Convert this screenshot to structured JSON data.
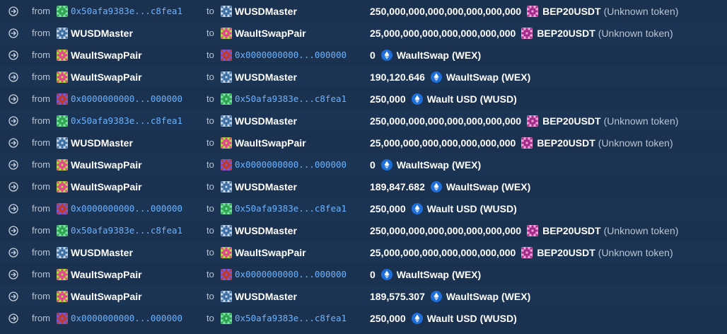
{
  "labels": {
    "from": "from",
    "to": "to"
  },
  "entities": {
    "addr50": {
      "text": "0x50afa9383e...c8fea1",
      "kind": "address",
      "avatar_colors": [
        "#2ea44f",
        "#7ee2a8"
      ]
    },
    "zero": {
      "text": "0x0000000000...000000",
      "kind": "address",
      "avatar_colors": [
        "#c0392b",
        "#6c5ce7"
      ]
    },
    "master": {
      "text": "WUSDMaster",
      "kind": "name",
      "avatar_colors": [
        "#3a6ea5",
        "#c9d6e3"
      ]
    },
    "pair": {
      "text": "WaultSwapPair",
      "kind": "name",
      "avatar_colors": [
        "#e84393",
        "#a3e635"
      ]
    }
  },
  "tokens": {
    "usdt": {
      "name": "BEP20USDT",
      "symbol": "(Unknown token)",
      "icon": "pixel-avatar-icon",
      "colors": [
        "#a32b8a",
        "#f0a6d8"
      ]
    },
    "wex": {
      "name": "WaultSwap",
      "symbol": "(WEX)",
      "icon": "eth-diamond-icon",
      "colors": [
        "#1e6fd9",
        "#ffffff"
      ]
    },
    "wusd": {
      "name": "Wault USD",
      "symbol": "(WUSD)",
      "icon": "eth-diamond-icon",
      "colors": [
        "#1e6fd9",
        "#ffffff"
      ]
    }
  },
  "transfers": [
    {
      "from": "addr50",
      "to": "master",
      "amount": "250,000,000,000,000,000,000,000",
      "token": "usdt"
    },
    {
      "from": "master",
      "to": "pair",
      "amount": "25,000,000,000,000,000,000,000",
      "token": "usdt"
    },
    {
      "from": "pair",
      "to": "zero",
      "amount": "0",
      "token": "wex"
    },
    {
      "from": "pair",
      "to": "master",
      "amount": "190,120.646",
      "token": "wex"
    },
    {
      "from": "zero",
      "to": "addr50",
      "amount": "250,000",
      "token": "wusd"
    },
    {
      "from": "addr50",
      "to": "master",
      "amount": "250,000,000,000,000,000,000,000",
      "token": "usdt"
    },
    {
      "from": "master",
      "to": "pair",
      "amount": "25,000,000,000,000,000,000,000",
      "token": "usdt"
    },
    {
      "from": "pair",
      "to": "zero",
      "amount": "0",
      "token": "wex"
    },
    {
      "from": "pair",
      "to": "master",
      "amount": "189,847.682",
      "token": "wex"
    },
    {
      "from": "zero",
      "to": "addr50",
      "amount": "250,000",
      "token": "wusd"
    },
    {
      "from": "addr50",
      "to": "master",
      "amount": "250,000,000,000,000,000,000,000",
      "token": "usdt"
    },
    {
      "from": "master",
      "to": "pair",
      "amount": "25,000,000,000,000,000,000,000",
      "token": "usdt"
    },
    {
      "from": "pair",
      "to": "zero",
      "amount": "0",
      "token": "wex"
    },
    {
      "from": "pair",
      "to": "master",
      "amount": "189,575.307",
      "token": "wex"
    },
    {
      "from": "zero",
      "to": "addr50",
      "amount": "250,000",
      "token": "wusd"
    }
  ]
}
